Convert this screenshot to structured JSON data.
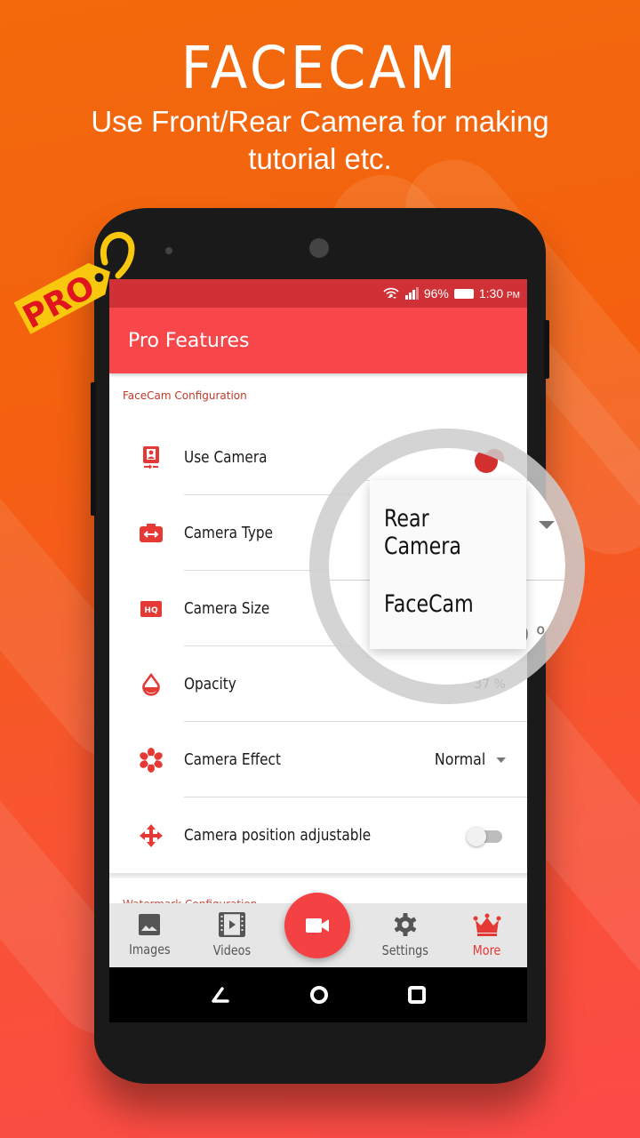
{
  "promo": {
    "title": "FACECAM",
    "subtitle_line1": "Use Front/Rear Camera for making",
    "subtitle_line2": "tutorial etc.",
    "badge": "PRO"
  },
  "colors": {
    "accent": "#f7474a",
    "status_bar": "#d03136",
    "section_header": "#c0392b",
    "badge_yellow": "#f9c80e",
    "badge_text": "#e0141c"
  },
  "status_bar": {
    "battery": "96%",
    "time": "1:30",
    "ampm": "PM"
  },
  "app_bar": {
    "title": "Pro Features"
  },
  "sections": {
    "facecam_header": "FaceCam Configuration",
    "watermark_header": "Watermark Configuration"
  },
  "settings": [
    {
      "label": "Use Camera",
      "icon": "camera-portrait-icon",
      "control": "toggle",
      "on": true
    },
    {
      "label": "Camera Type",
      "icon": "camera-switch-icon",
      "control": "dropdown",
      "value": "Rear Camera"
    },
    {
      "label": "Camera Size",
      "icon": "hq-icon",
      "control": "value",
      "value": "50 %"
    },
    {
      "label": "Opacity",
      "icon": "opacity-drop-icon",
      "control": "value",
      "value": "37 %"
    },
    {
      "label": "Camera Effect",
      "icon": "effect-flower-icon",
      "control": "dropdown",
      "value": "Normal"
    },
    {
      "label": "Camera position adjustable",
      "icon": "move-arrows-icon",
      "control": "toggle",
      "on": false
    }
  ],
  "popup": {
    "options": [
      "Rear Camera",
      "FaceCam"
    ]
  },
  "bottom_nav": [
    {
      "label": "Images",
      "icon": "image-icon",
      "active": false
    },
    {
      "label": "Videos",
      "icon": "film-icon",
      "active": false
    },
    {
      "label": "Settings",
      "icon": "gear-icon",
      "active": false
    },
    {
      "label": "More",
      "icon": "crown-icon",
      "active": true
    }
  ],
  "fab": {
    "icon": "video-camera-icon"
  },
  "system_nav": [
    "back-icon",
    "home-icon",
    "recents-icon"
  ]
}
